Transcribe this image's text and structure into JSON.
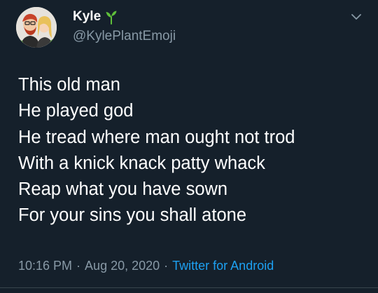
{
  "author": {
    "display_name": "Kyle",
    "badge_icon": "plant-sprout-icon",
    "handle": "@KylePlantEmoji"
  },
  "tweet": {
    "lines": [
      "This old man",
      "He played god",
      "He tread where man ought not trod",
      "With a knick knack patty whack",
      "Reap what you have sown",
      "For your sins you shall atone"
    ]
  },
  "meta": {
    "time": "10:16 PM",
    "separator": "·",
    "date": "Aug 20, 2020",
    "source": "Twitter for Android"
  },
  "colors": {
    "background": "#15202b",
    "text": "#ffffff",
    "secondary": "#8899a6",
    "link": "#1da1f2",
    "plant": "#5fbf3a"
  }
}
